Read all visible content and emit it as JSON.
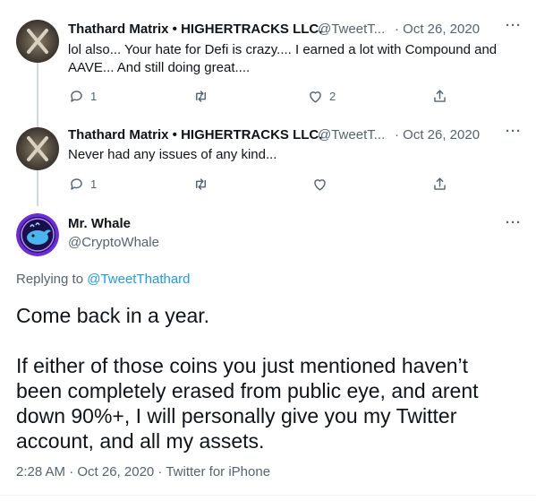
{
  "tweets": [
    {
      "name": "Thathard Matrix • HIGHERTRACKS LLC.",
      "handle": "@TweetT...",
      "date": "· Oct 26, 2020",
      "text_lines": [
        "lol also... Your hate for Defi is crazy.... I earned a lot with Compound and",
        "AAVE... And still doing great...."
      ],
      "reply_count": "1",
      "like_count": "2"
    },
    {
      "name": "Thathard Matrix • HIGHERTRACKS LLC.",
      "handle": "@TweetT...",
      "date": "· Oct 26, 2020",
      "text_lines": [
        "Never had any issues of any kind..."
      ],
      "reply_count": "1",
      "like_count": ""
    }
  ],
  "main": {
    "name": "Mr. Whale",
    "handle": "@CryptoWhale",
    "replying_prefix": "Replying to",
    "replying_to": "@TweetThathard",
    "body_para1": "Come back in a year.",
    "body_para2_lines": [
      "If either of those coins you just mentioned haven’t",
      "been completely erased from public eye, and arent",
      "down 90%+, I will personally give you my Twitter",
      "account, and all my assets."
    ],
    "timestamp": "2:28 AM · Oct 26, 2020 · Twitter for iPhone"
  },
  "more_label": "···",
  "icons": [
    "reply-icon",
    "retweet-icon",
    "like-icon",
    "share-icon",
    "more-icon"
  ],
  "colors": {
    "accent": "#1d9bf0",
    "muted": "#536471",
    "text": "#0f1419",
    "thread": "#cfd9de"
  }
}
